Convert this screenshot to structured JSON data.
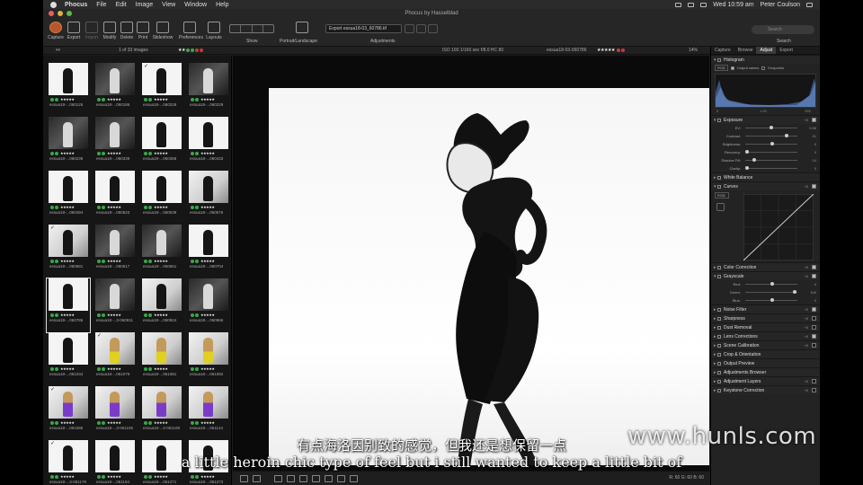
{
  "menubar": {
    "app": "Phocus",
    "items": [
      "File",
      "Edit",
      "Image",
      "View",
      "Window",
      "Help"
    ],
    "clock": "Wed 10:59 am",
    "user": "Peter Coulson"
  },
  "window_title": "Phocus by Hasselblad",
  "toolbar": {
    "buttons": [
      "Capture",
      "Export",
      "Import",
      "Modify",
      "Delete",
      "Print",
      "Slideshow",
      "Preferences",
      "Layouts"
    ],
    "show_label": "Show",
    "portrait_label": "Portrait/Landscape",
    "export_field": "Export essua18-03_60786.tif",
    "adjustments_label": "Adjustments",
    "search_placeholder": "Search",
    "search_label": "Search"
  },
  "subbar": {
    "count": "1 of 33 images",
    "exif": "ISO 100  1/160 sec  f/8.0  HC 80",
    "file": "essua18-03-060786",
    "zoom": "14%"
  },
  "thumbs": [
    {
      "name": "essua18-...060126",
      "tone": "white",
      "check": false
    },
    {
      "name": "essua18-...060186",
      "tone": "dark",
      "check": false
    },
    {
      "name": "essua18-...060228",
      "tone": "white",
      "check": true
    },
    {
      "name": "essua18-...060229",
      "tone": "dark",
      "check": false
    },
    {
      "name": "essua18-...060239",
      "tone": "dark",
      "check": true
    },
    {
      "name": "essua18-...060339",
      "tone": "dark",
      "check": true
    },
    {
      "name": "essua18-...060368",
      "tone": "white",
      "check": false
    },
    {
      "name": "essua18-...060433",
      "tone": "white",
      "check": false
    },
    {
      "name": "essua18-...060494",
      "tone": "white",
      "check": false
    },
    {
      "name": "essua18-...060523",
      "tone": "white",
      "check": false
    },
    {
      "name": "essua18-...060539",
      "tone": "white",
      "check": false
    },
    {
      "name": "essua18-...060576",
      "tone": "grey",
      "check": false
    },
    {
      "name": "essua18-...060581",
      "tone": "grey",
      "check": true
    },
    {
      "name": "essua18-...060617",
      "tone": "dark",
      "check": false
    },
    {
      "name": "essua18-...060661",
      "tone": "dark",
      "check": true
    },
    {
      "name": "essua18-...060704",
      "tone": "white",
      "check": false
    },
    {
      "name": "essua18-...060786",
      "tone": "white",
      "check": false,
      "selected": true
    },
    {
      "name": "essua18-...3-060911",
      "tone": "dark",
      "check": true
    },
    {
      "name": "essua18-...060924",
      "tone": "grey",
      "check": false
    },
    {
      "name": "essua18-...060966",
      "tone": "dark",
      "check": false
    },
    {
      "name": "essua18-...061034",
      "tone": "white",
      "check": false
    },
    {
      "name": "essua18-...061079",
      "tone": "yellow",
      "check": true
    },
    {
      "name": "essua18-...061081",
      "tone": "yellow",
      "check": false
    },
    {
      "name": "essua18-...061082",
      "tone": "yellow",
      "check": false
    },
    {
      "name": "essua18-...061085",
      "tone": "purple",
      "check": true
    },
    {
      "name": "essua18-...3-061106",
      "tone": "purple",
      "check": false
    },
    {
      "name": "essua18-...3-061108",
      "tone": "purple",
      "check": false
    },
    {
      "name": "essua18-...061144",
      "tone": "purple",
      "check": false
    },
    {
      "name": "essua18-...3-061179",
      "tone": "white",
      "check": true
    },
    {
      "name": "essua18-...061184",
      "tone": "white",
      "check": false
    },
    {
      "name": "essua18-...061271",
      "tone": "white",
      "check": false
    },
    {
      "name": "essua18-...061273",
      "tone": "white",
      "check": false
    }
  ],
  "panel": {
    "tabs": [
      "Capture",
      "Browse",
      "Adjust",
      "Export"
    ],
    "active_tab": "Adjust",
    "histogram": {
      "title": "Histogram",
      "channel": "RGB",
      "output_values": "Output values",
      "endpoints": "Endpoints",
      "scale_left": "0",
      "scale_mid": "1.00",
      "scale_right": "255"
    },
    "exposure": {
      "title": "Exposure",
      "sliders": [
        {
          "label": "EV:",
          "value": "0.56",
          "pos": 0.48
        },
        {
          "label": "Contrast:",
          "value": "21",
          "pos": 0.78
        },
        {
          "label": "Brightness:",
          "value": "0",
          "pos": 0.5
        },
        {
          "label": "Recovery:",
          "value": "0",
          "pos": 0.0
        },
        {
          "label": "Shadow Fill:",
          "value": "14",
          "pos": 0.14
        },
        {
          "label": "Clarity:",
          "value": "0",
          "pos": 0.0
        }
      ]
    },
    "white_balance": "White Balance",
    "curves": {
      "title": "Curves",
      "channel": "RGB"
    },
    "color_correction": "Color Correction",
    "grayscale": {
      "title": "Grayscale",
      "sliders": [
        {
          "label": "Red:",
          "value": "0",
          "pos": 0.5
        },
        {
          "label": "Green:",
          "value": "100",
          "pos": 0.95
        },
        {
          "label": "Blue:",
          "value": "0",
          "pos": 0.5
        }
      ]
    },
    "tools": [
      {
        "label": "Noise Filter",
        "check": true
      },
      {
        "label": "Sharpness",
        "check": false
      },
      {
        "label": "Dust Removal",
        "check": false
      },
      {
        "label": "Lens Corrections",
        "check": true
      },
      {
        "label": "Scene Calibration",
        "check": false
      },
      {
        "label": "Crop & Orientation",
        "check": null
      },
      {
        "label": "Output Preview",
        "check": null
      },
      {
        "label": "Adjustments Browser",
        "check": null
      },
      {
        "label": "Adjustment Layers",
        "check": false
      },
      {
        "label": "Keystone Correction",
        "check": false
      }
    ]
  },
  "readout": "R:  60  G:  60  B:  60",
  "subtitle_cn": "有点海洛因别致的感觉，但我还是想保留一点",
  "subtitle_en": "a little heroin chic type of feel but i still wanted to keep a little bit of",
  "watermark": "www.hunls.com",
  "colors": {
    "accent": "#b5562c",
    "flag_green": "#3aa64a",
    "flag_red": "#c63a3a"
  }
}
